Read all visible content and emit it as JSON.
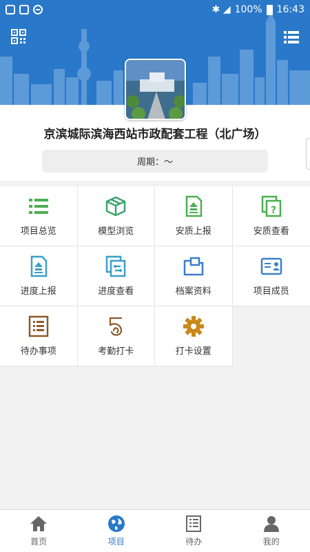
{
  "status_bar": {
    "battery": "100%",
    "time": "16:43"
  },
  "project": {
    "title": "京滨城际滨海西站市政配套工程（北广场）",
    "period_label": "周期：～"
  },
  "grid": [
    {
      "label": "项目总览",
      "icon": "list-icon",
      "color": "#4caf50"
    },
    {
      "label": "模型浏览",
      "icon": "cube-icon",
      "color": "#3aa46b"
    },
    {
      "label": "安质上报",
      "icon": "upload-doc-icon",
      "color": "#4caf50"
    },
    {
      "label": "安质查看",
      "icon": "question-doc-icon",
      "color": "#4caf50"
    },
    {
      "label": "进度上报",
      "icon": "upload-doc-icon",
      "color": "#3a9ec9"
    },
    {
      "label": "进度查看",
      "icon": "flow-doc-icon",
      "color": "#3a9ec9"
    },
    {
      "label": "档案资料",
      "icon": "folder-icon",
      "color": "#3a7fc9"
    },
    {
      "label": "项目成员",
      "icon": "id-card-icon",
      "color": "#3a7fc9"
    },
    {
      "label": "待办事项",
      "icon": "todo-list-icon",
      "color": "#8a5a2b"
    },
    {
      "label": "考勤打卡",
      "icon": "fingerprint-icon",
      "color": "#8a5a2b"
    },
    {
      "label": "打卡设置",
      "icon": "gear-icon",
      "color": "#c98a1a"
    }
  ],
  "nav": [
    {
      "label": "首页",
      "icon": "home-icon",
      "active": false
    },
    {
      "label": "项目",
      "icon": "globe-icon",
      "active": true
    },
    {
      "label": "待办",
      "icon": "list-doc-icon",
      "active": false
    },
    {
      "label": "我的",
      "icon": "user-icon",
      "active": false
    }
  ],
  "colors": {
    "accent": "#2a78c9",
    "banner": "#2a78c9"
  }
}
